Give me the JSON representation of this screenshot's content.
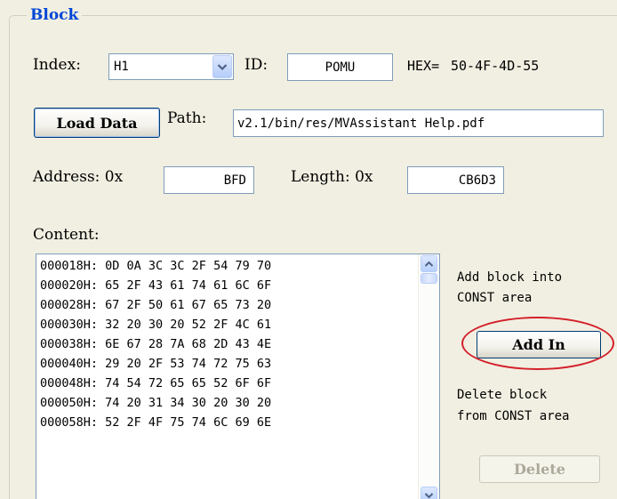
{
  "group": {
    "title": "Block"
  },
  "index": {
    "label": "Index:",
    "value": "H1"
  },
  "id": {
    "label": "ID:",
    "value": "POMU"
  },
  "hex": {
    "label": "HEX=",
    "value": "50-4F-4D-55"
  },
  "load_data": {
    "label": "Load Data"
  },
  "path": {
    "label": "Path:",
    "value": "v2.1/bin/res/MVAssistant Help.pdf"
  },
  "address": {
    "label": "Address: 0x",
    "value": "BFD"
  },
  "length": {
    "label": "Length: 0x",
    "value": "CB6D3"
  },
  "content": {
    "label": "Content:",
    "rows": [
      "000018H: 0D 0A 3C 3C 2F 54 79 70",
      "000020H: 65 2F 43 61 74 61 6C 6F",
      "000028H: 67 2F 50 61 67 65 73 20",
      "000030H: 32 20 30 20 52 2F 4C 61",
      "000038H: 6E 67 28 7A 68 2D 43 4E",
      "000040H: 29 20 2F 53 74 72 75 63",
      "000048H: 74 54 72 65 65 52 6F 6F",
      "000050H: 74 20 31 34 30 20 30 20",
      "000058H: 52 2F 4F 75 74 6C 69 6E"
    ]
  },
  "add": {
    "hint_line1": "Add block into",
    "hint_line2": "CONST area",
    "button": "Add In"
  },
  "delete": {
    "hint_line1": "Delete block",
    "hint_line2": "from CONST area",
    "button": "Delete"
  },
  "colors": {
    "title": "#0046d5",
    "annotation": "#d4202a",
    "field_border": "#7f9db9"
  }
}
